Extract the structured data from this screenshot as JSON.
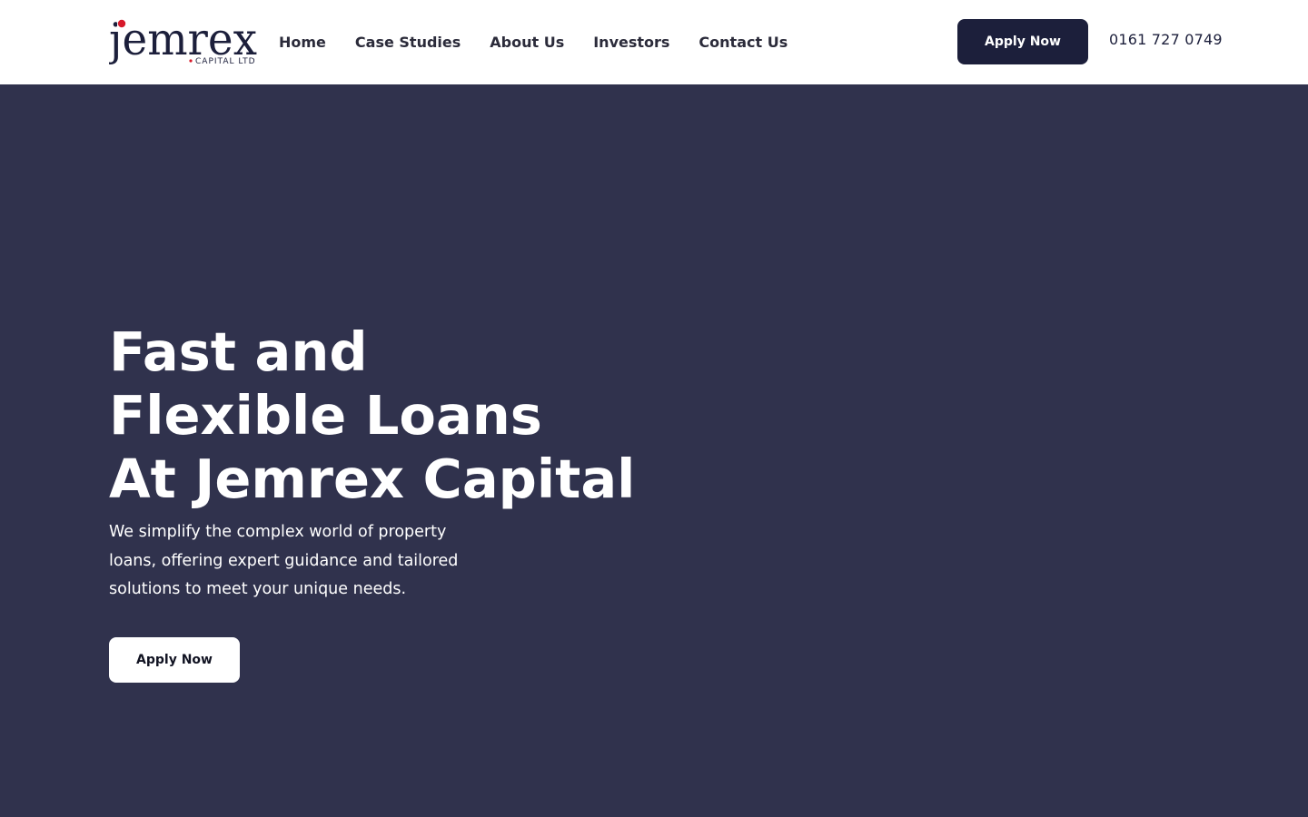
{
  "brand": {
    "logo_word": "jemrex",
    "logo_sub": "CAPITAL LTD",
    "primary_color": "#1c1f3b",
    "accent_color": "#d7192a"
  },
  "header": {
    "nav": [
      {
        "label": "Home"
      },
      {
        "label": "Case Studies"
      },
      {
        "label": "About Us"
      },
      {
        "label": "Investors"
      },
      {
        "label": "Contact Us"
      }
    ],
    "apply_label": "Apply Now",
    "phone": "0161 727 0749"
  },
  "hero": {
    "title_lines": [
      "Fast and",
      "Flexible Loans",
      "At Jemrex Capital"
    ],
    "subtitle": "We simplify the complex world of property loans, offering expert guidance and tailored solutions to meet your unique needs.",
    "cta_label": "Apply Now",
    "background_color": "#30324d"
  }
}
